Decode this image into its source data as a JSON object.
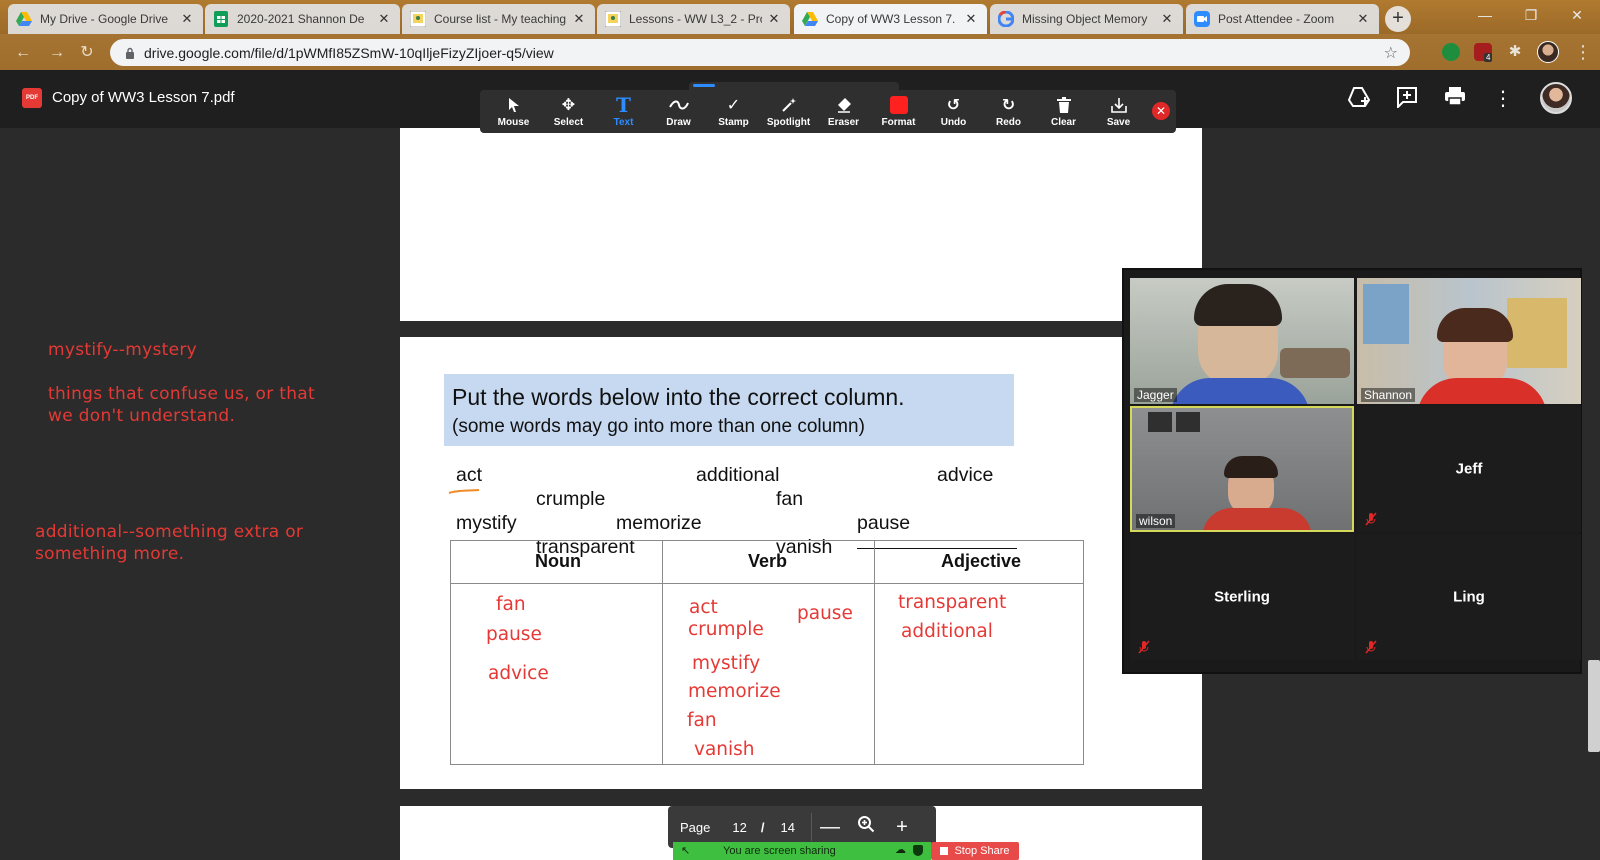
{
  "browser": {
    "tabs": [
      {
        "label": "My Drive - Google Drive",
        "icon": "google-drive-icon",
        "active": false
      },
      {
        "label": "2020-2021 Shannon De",
        "icon": "google-sheets-icon",
        "active": false
      },
      {
        "label": "Course list - My teaching",
        "icon": "classroom-icon",
        "active": false
      },
      {
        "label": "Lessons - WW L3_2 - Pro",
        "icon": "classroom-icon",
        "active": false
      },
      {
        "label": "Copy of WW3 Lesson 7.",
        "icon": "google-drive-icon",
        "active": true
      },
      {
        "label": "Missing Object Memory",
        "icon": "google-icon",
        "active": false
      },
      {
        "label": "Post Attendee - Zoom",
        "icon": "zoom-icon",
        "active": false
      }
    ],
    "new_tab_label": "+",
    "url": "drive.google.com/file/d/1pWMfI85ZSmW-10qIljeFizyZIjoer-q5/view",
    "extension_badge": "4"
  },
  "viewer": {
    "file_icon_text": "PDF",
    "file_title": "Copy of WW3 Lesson 7.pdf",
    "header_icons": [
      "add-to-drive-icon",
      "add-comment-icon",
      "print-icon",
      "more-vert-icon"
    ]
  },
  "annotation_toolbar": {
    "tools": [
      {
        "label": "Mouse",
        "icon": "cursor-icon",
        "active": false
      },
      {
        "label": "Select",
        "icon": "move-icon",
        "active": false
      },
      {
        "label": "Text",
        "icon": "text-icon",
        "active": true
      },
      {
        "label": "Draw",
        "icon": "squiggle-icon",
        "active": false
      },
      {
        "label": "Stamp",
        "icon": "checkmark-icon",
        "active": false
      },
      {
        "label": "Spotlight",
        "icon": "wand-icon",
        "active": false
      },
      {
        "label": "Eraser",
        "icon": "eraser-icon",
        "active": false
      },
      {
        "label": "Format",
        "icon": "color-swatch-icon",
        "active": false
      },
      {
        "label": "Undo",
        "icon": "undo-icon",
        "active": false
      },
      {
        "label": "Redo",
        "icon": "redo-icon",
        "active": false
      },
      {
        "label": "Clear",
        "icon": "trash-icon",
        "active": false
      },
      {
        "label": "Save",
        "icon": "save-icon",
        "active": false
      }
    ],
    "format_color": "#ff2020"
  },
  "notes": {
    "note1_line1": "mystify--mystery",
    "note2_line1": "things that confuse us, or that",
    "note2_line2": "we don't understand.",
    "note3_line1": "additional--something extra or",
    "note3_line2": "something more."
  },
  "worksheet": {
    "instruction": "Put the words below into the correct column.",
    "subinstruction": "(some words may go into more than one column)",
    "words": [
      "act",
      "additional",
      "advice",
      "crumple",
      "fan",
      "mystify",
      "memorize",
      "pause",
      "transparent",
      "vanish"
    ],
    "columns": [
      "Noun",
      "Verb",
      "Adjective"
    ],
    "answers": {
      "noun": [
        "fan",
        "pause",
        "advice"
      ],
      "verb": [
        "act",
        "crumple",
        "pause",
        "mystify",
        "memorize",
        "fan",
        "vanish"
      ],
      "adjective": [
        "transparent",
        "additional"
      ]
    }
  },
  "page_control": {
    "label": "Page",
    "current": "12",
    "separator": "/",
    "total": "14",
    "zoom_out": "—",
    "zoom_in": "+"
  },
  "screen_share": {
    "status": "You are screen sharing",
    "stop_label": "Stop Share"
  },
  "participants": [
    {
      "name": "Jagger",
      "video": true,
      "muted": false
    },
    {
      "name": "Shannon",
      "video": true,
      "muted": false
    },
    {
      "name": "wilson",
      "video": true,
      "muted": true
    },
    {
      "name": "Jeff",
      "video": false,
      "muted": false
    },
    {
      "name": "Sterling",
      "video": false,
      "muted": true
    },
    {
      "name": "Ling",
      "video": false,
      "muted": true
    }
  ],
  "colors": {
    "annotation_red": "#e53935",
    "zoom_blue": "#2d8cff",
    "instruction_bg": "#c6d9f1",
    "share_green": "#3fbf3f",
    "stop_red": "#e84a4a",
    "active_speaker": "#d6d85b"
  }
}
